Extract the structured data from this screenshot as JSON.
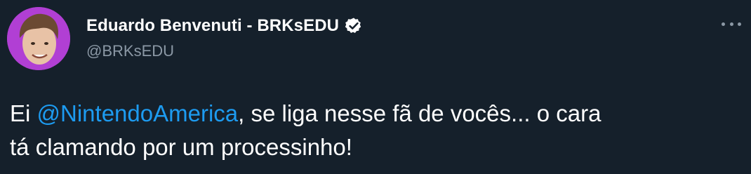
{
  "tweet": {
    "author": {
      "display_name": "Eduardo Benvenuti - BRKsEDU",
      "handle": "@BRKsEDU",
      "verified_icon": "verified-badge-icon",
      "avatar_icon": "avatar-photo"
    },
    "more_icon": "more-options-icon",
    "text": {
      "part1": "Ei ",
      "mention": "@NintendoAmerica",
      "part2": ", se liga nesse fã de vocês... o cara",
      "line2": "tá clamando por um processinho!"
    }
  },
  "colors": {
    "background": "#15202b",
    "text": "#ffffff",
    "secondary": "#8b98a5",
    "link": "#1d9bf0",
    "avatar_ring": "#b13fd4"
  }
}
